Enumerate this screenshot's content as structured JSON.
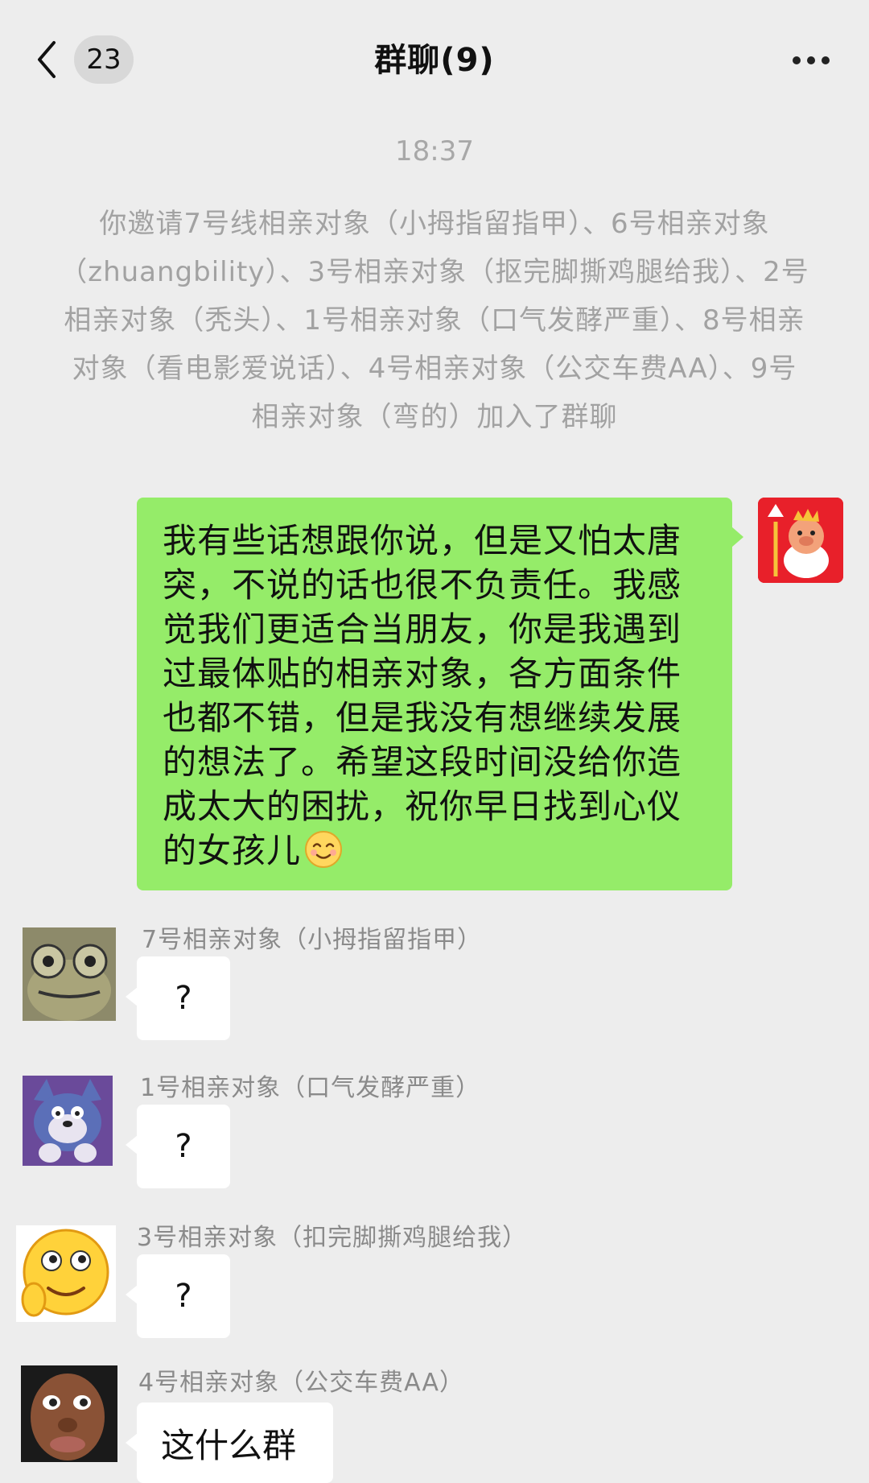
{
  "header": {
    "back_icon": "chevron-left-icon",
    "unread_count": "23",
    "title": "群聊(9)",
    "more_icon": "more-dots-icon"
  },
  "chat": {
    "timestamp": "18:37",
    "system_message": "你邀请7号线相亲对象（小拇指留指甲）、6号相亲对象（zhuangbility）、3号相亲对象（抠完脚撕鸡腿给我）、2号相亲对象（秃头）、1号相亲对象（口气发酵严重）、8号相亲对象（看电影爱说话）、4号相亲对象（公交车费AA）、9号相亲对象（弯的）加入了群聊",
    "my_message": {
      "text": "我有些话想跟你说，但是又怕太唐突，不说的话也很不负责任。我感觉我们更适合当朋友，你是我遇到过最体贴的相亲对象，各方面条件也都不错，但是我没有想继续发展的想法了。希望这段时间没给你造成太大的困扰，祝你早日找到心仪的女孩儿",
      "emoji": "smile-emoji-icon",
      "avatar": "pig-king-avatar"
    },
    "replies": [
      {
        "nickname": "7号相亲对象（小拇指留指甲）",
        "text": "?",
        "avatar": "frog-avatar"
      },
      {
        "nickname": "1号相亲对象（口气发酵严重）",
        "text": "?",
        "avatar": "tom-cat-avatar"
      },
      {
        "nickname": "3号相亲对象（扣完脚撕鸡腿给我）",
        "text": "?",
        "avatar": "smiley-emoji-avatar"
      },
      {
        "nickname": "4号相亲对象（公交车费AA）",
        "text": "这什么群",
        "avatar": "man-face-avatar"
      }
    ]
  },
  "colors": {
    "background": "#ededed",
    "my_bubble": "#95ec69",
    "other_bubble": "#ffffff",
    "meta_text": "#a2a2a2"
  }
}
